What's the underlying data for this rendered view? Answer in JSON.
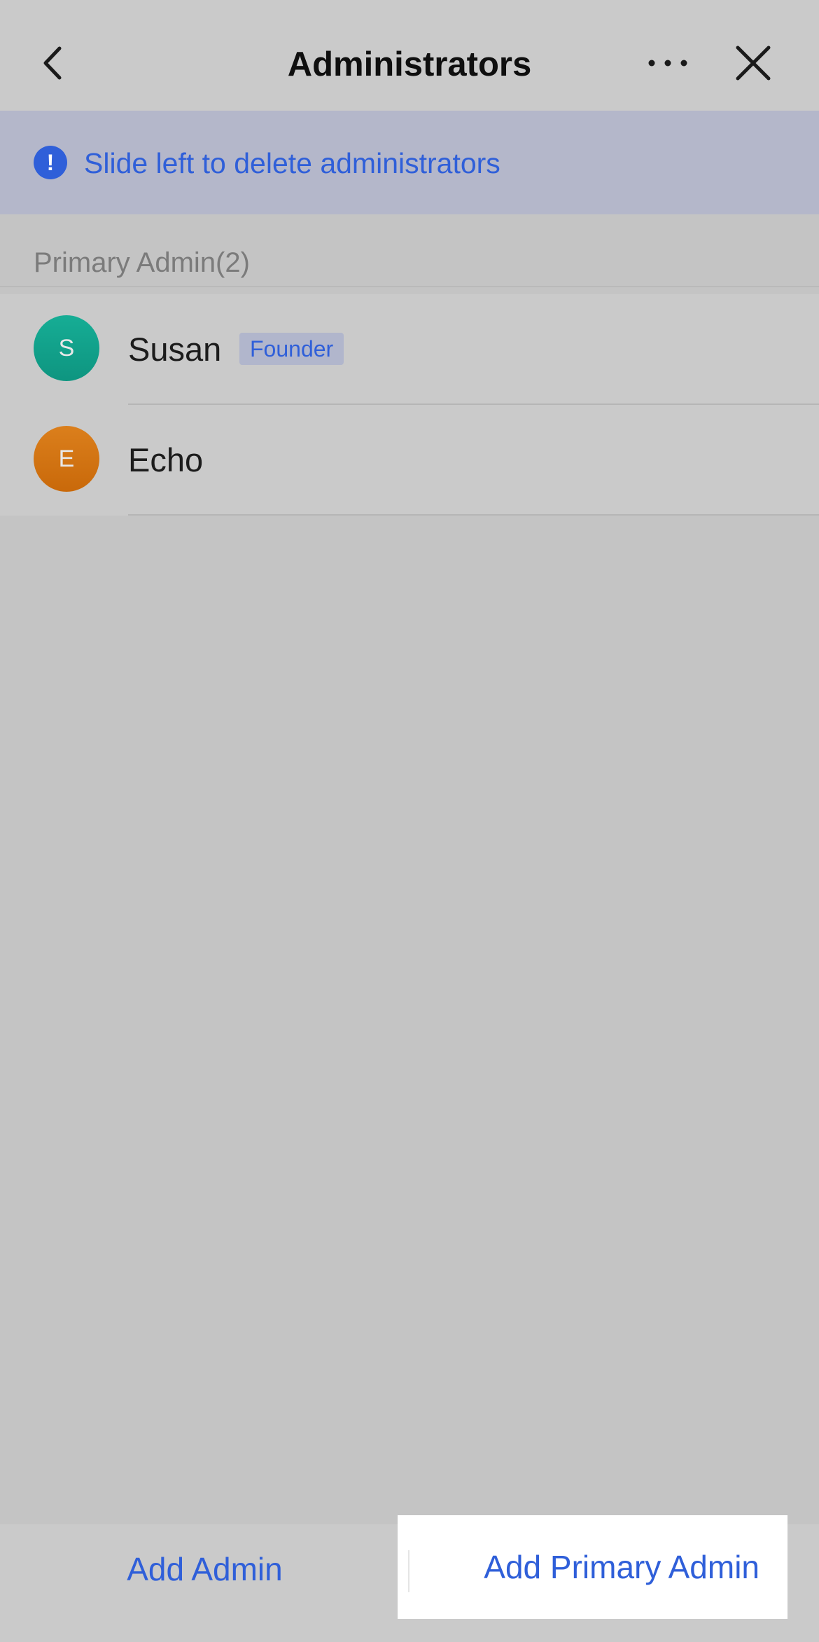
{
  "header": {
    "title": "Administrators",
    "back_icon": "chevron-left-icon",
    "more_icon": "ellipsis-icon",
    "close_icon": "close-icon"
  },
  "banner": {
    "icon": "exclamation-icon",
    "icon_glyph": "!",
    "text": "Slide left to delete administrators",
    "color": "#2f5fd9"
  },
  "section": {
    "title": "Primary Admin(2)"
  },
  "admins": [
    {
      "initial": "S",
      "name": "Susan",
      "badge": "Founder",
      "avatar_color": "#12a08a"
    },
    {
      "initial": "E",
      "name": "Echo",
      "avatar_color": "#d4760f"
    }
  ],
  "bottom_bar": {
    "add_admin_label": "Add Admin",
    "add_primary_admin_label": "Add Primary Admin"
  }
}
